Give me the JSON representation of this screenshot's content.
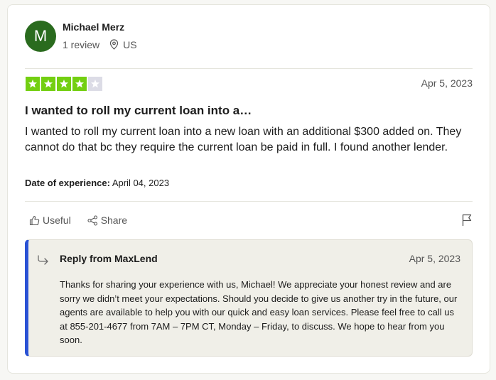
{
  "reviewer": {
    "initial": "M",
    "name": "Michael Merz",
    "reviews": "1 review",
    "country": "US",
    "avatar_color": "#2a6b1e"
  },
  "review": {
    "rating": 4,
    "max_rating": 5,
    "star_color": "#73cf11",
    "date": "Apr 5, 2023",
    "title": "I wanted to roll my current loan into a…",
    "body": "I wanted to roll my current loan into a new loan with an additional $300 added on. They cannot do that bc they require the current loan be paid in full. I found another lender.",
    "experience_label": "Date of experience:",
    "experience_date": " April 04, 2023"
  },
  "actions": {
    "useful": "Useful",
    "share": "Share",
    "flag_icon": "flag-icon"
  },
  "reply": {
    "title": "Reply from MaxLend",
    "date": "Apr 5, 2023",
    "text": "Thanks for sharing your experience with us, Michael! We appreciate your honest review and are sorry we didn’t meet your expectations. Should you decide to give us another try in the future, our agents are available to help you with our quick and easy loan services. Please feel free to call us at 855-201-4677 from 7AM – 7PM CT, Monday – Friday, to discuss. We hope to hear from you soon.",
    "accent_color": "#2a52d4"
  }
}
